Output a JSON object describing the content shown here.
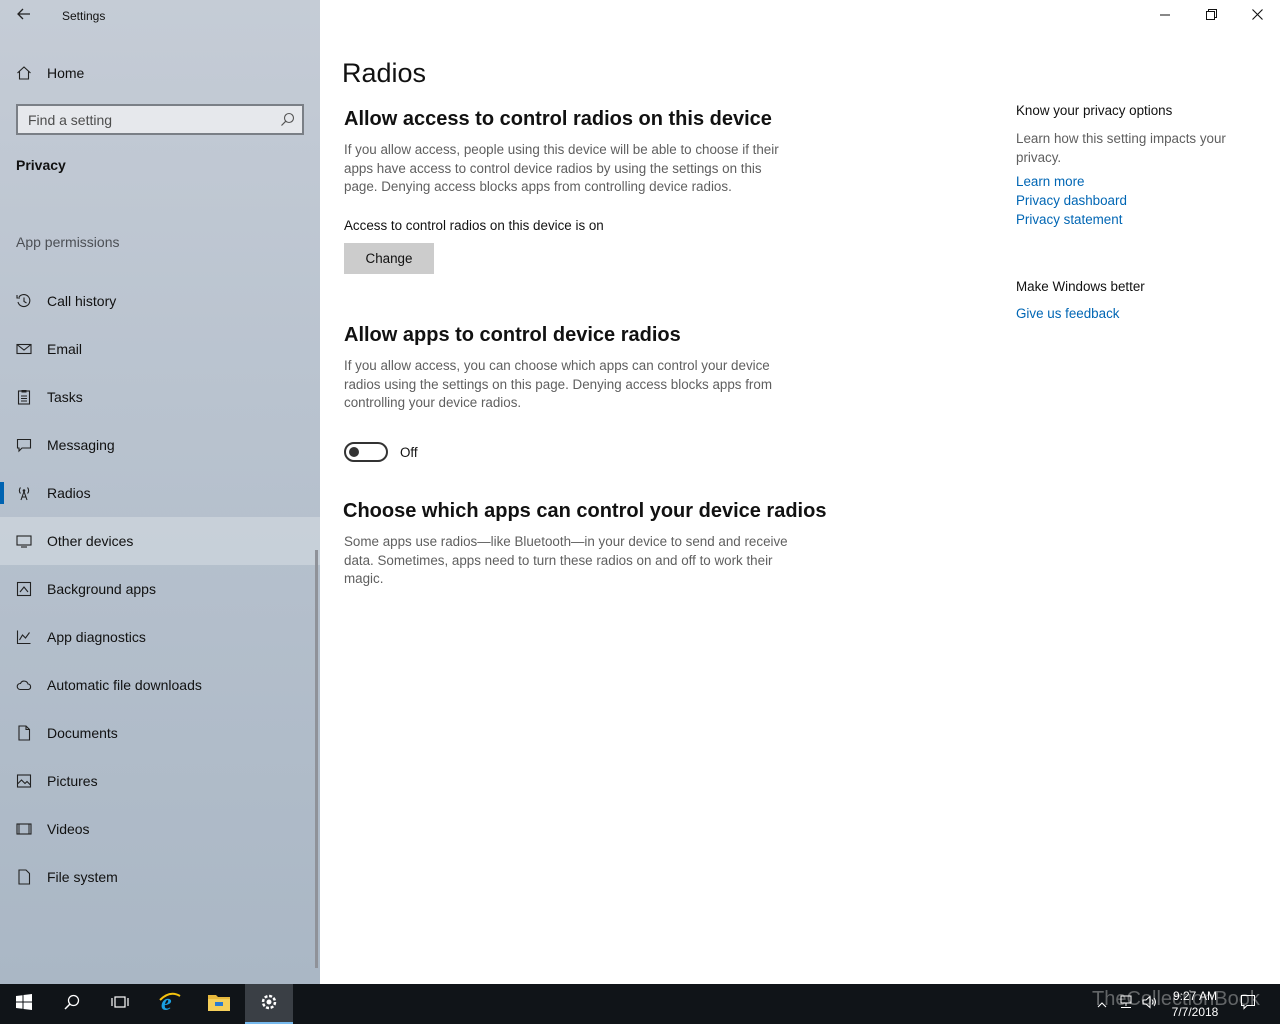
{
  "window": {
    "app_title": "Settings",
    "back_icon": "back-arrow-icon",
    "minimize_icon": "minimize-icon",
    "restore_icon": "restore-icon",
    "close_icon": "close-icon"
  },
  "sidebar": {
    "home_label": "Home",
    "search_placeholder": "Find a setting",
    "section_title": "Privacy",
    "group_label": "App permissions",
    "items": [
      {
        "label": "Call history",
        "icon": "call-history-icon"
      },
      {
        "label": "Email",
        "icon": "email-icon"
      },
      {
        "label": "Tasks",
        "icon": "tasks-icon"
      },
      {
        "label": "Messaging",
        "icon": "messaging-icon"
      },
      {
        "label": "Radios",
        "icon": "radio-tower-icon",
        "selected": true
      },
      {
        "label": "Other devices",
        "icon": "other-devices-icon",
        "hovered": true
      },
      {
        "label": "Background apps",
        "icon": "background-apps-icon"
      },
      {
        "label": "App diagnostics",
        "icon": "app-diagnostics-icon"
      },
      {
        "label": "Automatic file downloads",
        "icon": "cloud-icon"
      },
      {
        "label": "Documents",
        "icon": "document-icon"
      },
      {
        "label": "Pictures",
        "icon": "pictures-icon"
      },
      {
        "label": "Videos",
        "icon": "videos-icon"
      },
      {
        "label": "File system",
        "icon": "file-system-icon"
      }
    ]
  },
  "main": {
    "page_title": "Radios",
    "device_section": {
      "heading": "Allow access to control radios on this device",
      "description": "If you allow access, people using this device will be able to choose if their apps have access to control device radios by using the settings on this page. Denying access blocks apps from controlling device radios.",
      "status": "Access to control radios on this device is on",
      "button_label": "Change"
    },
    "apps_section": {
      "heading": "Allow apps to control device radios",
      "description": "If you allow access, you can choose which apps can control your device radios using the settings on this page. Denying access blocks apps from controlling your device radios.",
      "toggle_state": "Off"
    },
    "choose_section": {
      "heading": "Choose which apps can control your device radios",
      "description": "Some apps use radios—like Bluetooth—in your device to send and receive data. Sometimes, apps need to turn these radios on and off to work their magic."
    }
  },
  "right_panel": {
    "privacy_title": "Know your privacy options",
    "privacy_desc": "Learn how this setting impacts your privacy.",
    "links": [
      "Learn more",
      "Privacy dashboard",
      "Privacy statement"
    ],
    "better_title": "Make Windows better",
    "feedback_link": "Give us feedback"
  },
  "taskbar": {
    "buttons": [
      "start-icon",
      "search-icon",
      "task-view-icon",
      "internet-explorer-icon",
      "file-explorer-icon",
      "settings-gear-icon"
    ],
    "time": "9:27 AM",
    "date": "7/7/2018",
    "watermark": "TheCollectionBook"
  },
  "colors": {
    "accent": "#0063b1",
    "link": "#0066b4",
    "sidebar_bg": "#b9c3cf",
    "taskbar_bg": "#101418"
  }
}
